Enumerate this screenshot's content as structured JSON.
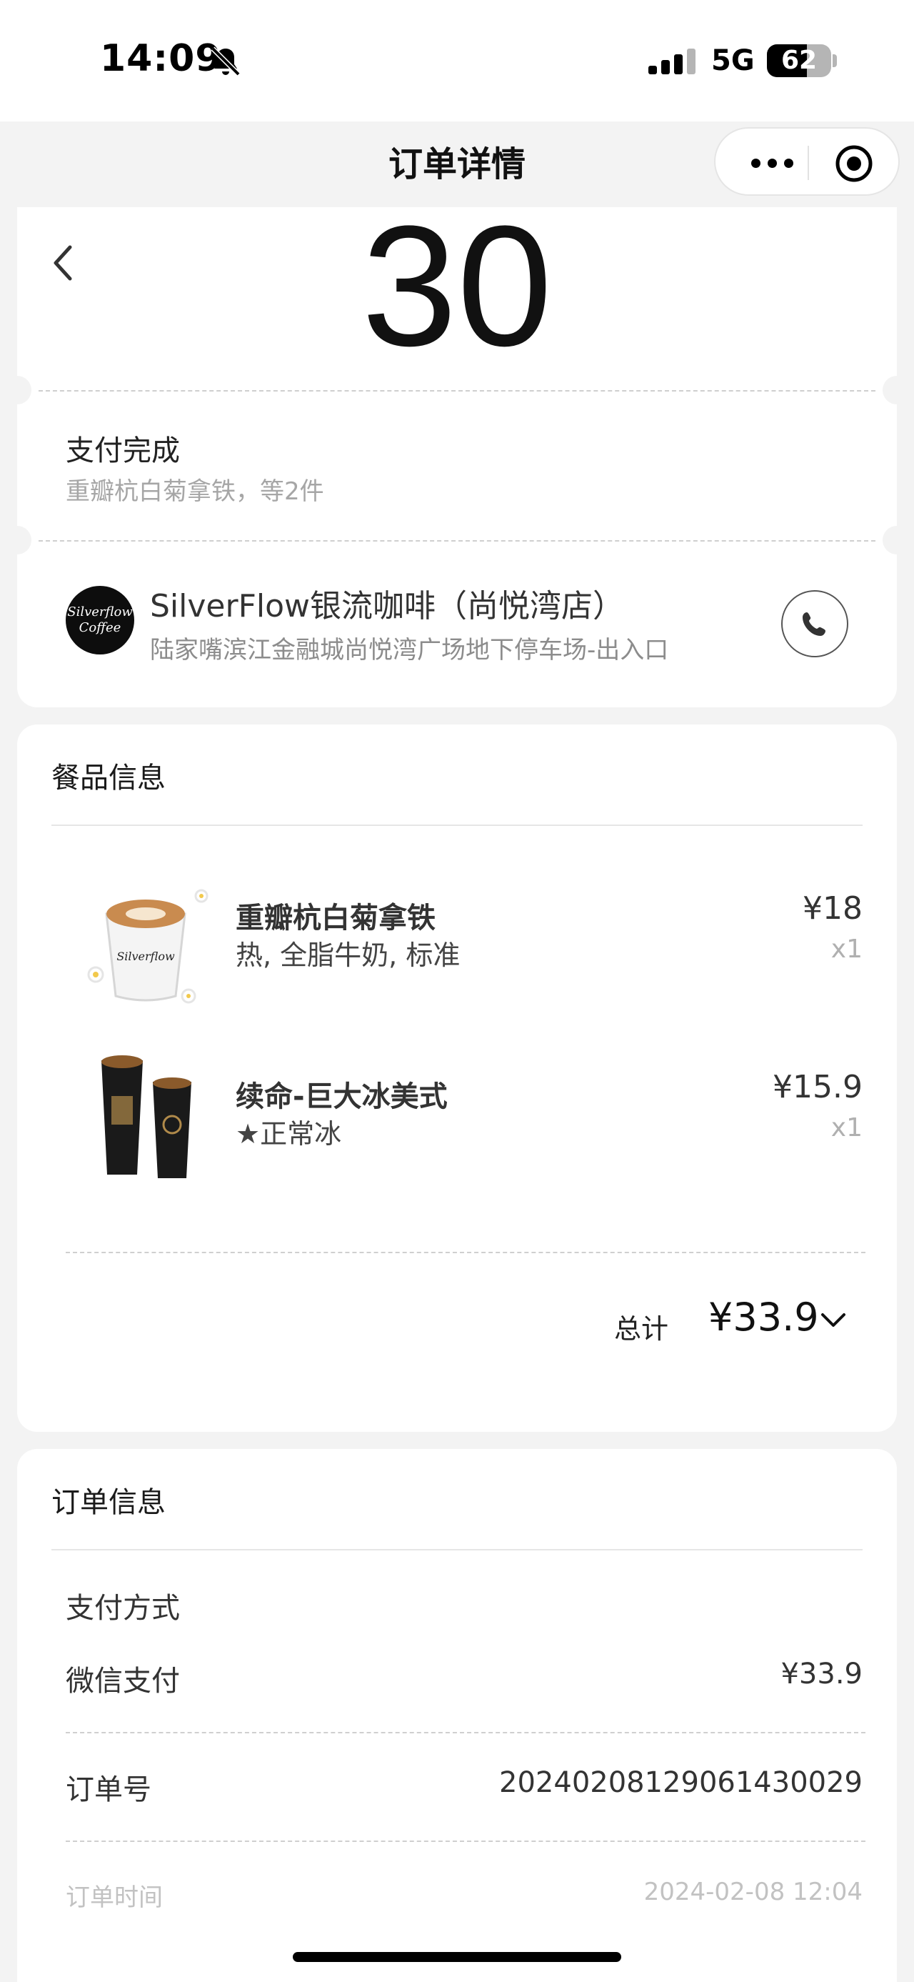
{
  "status_bar": {
    "time": "14:09",
    "network": "5G",
    "battery": "62",
    "battery_level_percent": 62,
    "icons": [
      "bell-off-icon",
      "signal-icon"
    ]
  },
  "nav": {
    "title": "订单详情",
    "icons": [
      "back-arrow-icon",
      "more-icon",
      "target-icon"
    ]
  },
  "pickup": {
    "number": "30"
  },
  "order_status": {
    "title": "支付完成",
    "subtitle": "重瓣杭白菊拿铁，等2件"
  },
  "store": {
    "logo_text_line1": "Silverflow",
    "logo_text_line2": "Coffee",
    "name": "SilverFlow银流咖啡（尚悦湾店）",
    "address": "陆家嘴滨江金融城尚悦湾广场地下停车场-出入口",
    "phone_icon": "phone-icon"
  },
  "items_section": {
    "title": "餐品信息",
    "items": [
      {
        "name": "重瓣杭白菊拿铁",
        "spec": "热, 全脂牛奶, 标准",
        "price": "¥18",
        "qty": "x1",
        "image": "latte-cup-image"
      },
      {
        "name": "续命-巨大冰美式",
        "spec": "★正常冰",
        "price": "¥15.9",
        "qty": "x1",
        "image": "iced-americano-cups-image"
      }
    ],
    "total_label": "总计",
    "total_value": "¥33.9",
    "chevron_icon": "chevron-down-icon"
  },
  "order_info": {
    "title": "订单信息",
    "payment_method_label": "支付方式",
    "payment_channel": "微信支付",
    "payment_amount": "¥33.9",
    "order_no_label": "订单号",
    "order_no": "20240208129061430029",
    "order_time_label": "订单时间",
    "order_time": "2024-02-08 12:04"
  },
  "colors": {
    "page_background": "#f3f3f3",
    "card_background": "#ffffff",
    "muted_text": "#a6a6a6"
  }
}
